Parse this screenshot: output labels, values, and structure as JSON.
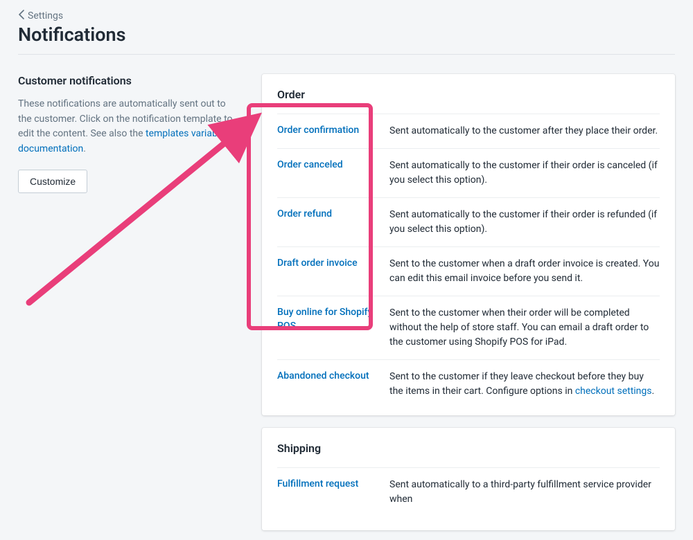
{
  "breadcrumb": {
    "label": "Settings"
  },
  "page": {
    "title": "Notifications"
  },
  "sidebar": {
    "title": "Customer notifications",
    "desc_prefix": "These notifications are automatically sent out to the customer. Click on the notification template to edit the content. See also the ",
    "desc_link": "templates variables documentation",
    "desc_suffix": ".",
    "customize_label": "Customize"
  },
  "order_card": {
    "title": "Order",
    "rows": [
      {
        "link": "Order confirmation",
        "desc": "Sent automatically to the customer after they place their order."
      },
      {
        "link": "Order canceled",
        "desc": "Sent automatically to the customer if their order is canceled (if you select this option)."
      },
      {
        "link": "Order refund",
        "desc": "Sent automatically to the customer if their order is refunded (if you select this option)."
      },
      {
        "link": "Draft order invoice",
        "desc": "Sent to the customer when a draft order invoice is created. You can edit this email invoice before you send it."
      },
      {
        "link": "Buy online for Shopify POS",
        "desc": "Sent to the customer when their order will be completed without the help of store staff. You can email a draft order to the customer using Shopify POS for iPad."
      },
      {
        "link": "Abandoned checkout",
        "desc_prefix": "Sent to the customer if they leave checkout before they buy the items in their cart. Configure options in ",
        "desc_link": "checkout settings",
        "desc_suffix": "."
      }
    ]
  },
  "shipping_card": {
    "title": "Shipping",
    "rows": [
      {
        "link": "Fulfillment request",
        "desc": "Sent automatically to a third-party fulfillment service provider when"
      }
    ]
  }
}
